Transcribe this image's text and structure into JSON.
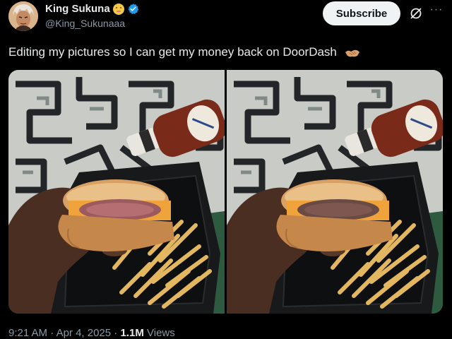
{
  "author": {
    "display_name": "King Sukuna",
    "handle": "@King_Sukunaaa",
    "verified": true,
    "badge_icon": "flushed-face-icon",
    "verified_icon": "verified-badge-icon"
  },
  "actions": {
    "subscribe_label": "Subscribe",
    "grok_icon": "grok-icon",
    "more_icon": "more-options-icon"
  },
  "tweet": {
    "text": "Editing my pictures so I can get my money back on DoorDash",
    "trailing_emoji": "handshake-icon"
  },
  "media": [
    {
      "label": "burger photo edited",
      "patty_color": "#9a5a5e"
    },
    {
      "label": "burger photo original",
      "patty_color": "#6a4a45"
    }
  ],
  "meta": {
    "time": "9:21 AM",
    "separator": "·",
    "date": "Apr 4, 2025",
    "views_count": "1.1M",
    "views_label": "Views"
  },
  "colors": {
    "background": "#000000",
    "text_primary": "#e7e9ea",
    "text_secondary": "#8b98a5",
    "verified_blue": "#1d9bf0",
    "subscribe_bg": "#eff3f4"
  }
}
